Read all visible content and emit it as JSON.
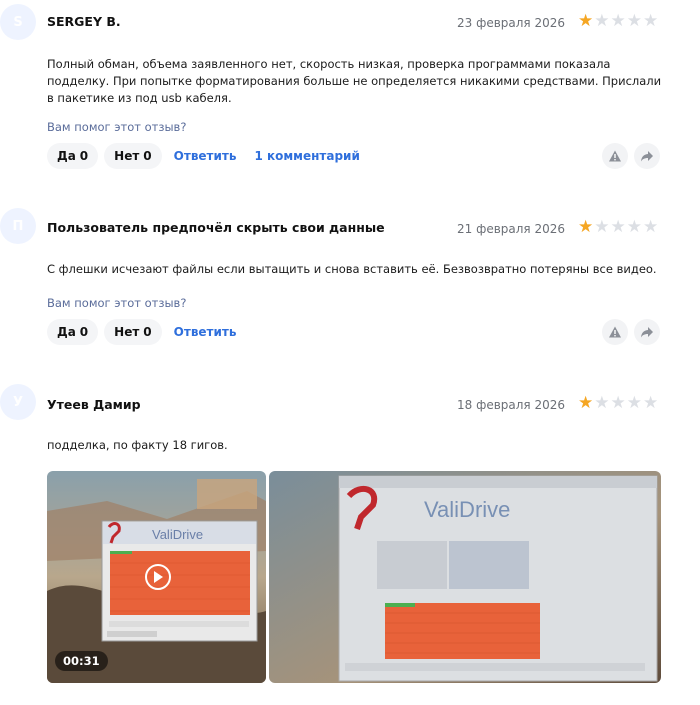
{
  "reviews": [
    {
      "avatar_letter": "S",
      "author": "SERGEY B.",
      "date": "23 февраля 2026",
      "rating": 1,
      "text": "Полный обман, объема заявленного нет, скорость низкая, проверка программами показала подделку. При попытке форматирования больше не определяется никакими средствами. Прислали в пакетике из под usb кабеля.",
      "helpful_question": "Вам помог этот отзыв?",
      "yes_label": "Да",
      "yes_count": "0",
      "no_label": "Нет",
      "no_count": "0",
      "reply_label": "Ответить",
      "comments_label": "1 комментарий"
    },
    {
      "avatar_letter": "П",
      "author": "Пользователь предпочёл скрыть свои данные",
      "date": "21 февраля 2026",
      "rating": 1,
      "text": "С флешки исчезают файлы если вытащить и снова вставить её. Безвозвратно потеряны все видео.",
      "helpful_question": "Вам помог этот отзыв?",
      "yes_label": "Да",
      "yes_count": "0",
      "no_label": "Нет",
      "no_count": "0",
      "reply_label": "Ответить"
    },
    {
      "avatar_letter": "У",
      "author": "Утеев Дамир",
      "date": "18 февраля 2026",
      "rating": 1,
      "text": "подделка, по факту 18 гигов.",
      "media": {
        "video_duration": "00:31",
        "video_app_title": "ValiDrive",
        "photo_app_title": "ValiDrive"
      }
    }
  ],
  "colors": {
    "star_on": "#f5a623",
    "star_off": "#dcdfe4",
    "link": "#2f6fdc",
    "avatar_bg": "#eef3ff"
  },
  "icons": [
    "star-icon",
    "warning-icon",
    "share-icon",
    "play-icon"
  ]
}
